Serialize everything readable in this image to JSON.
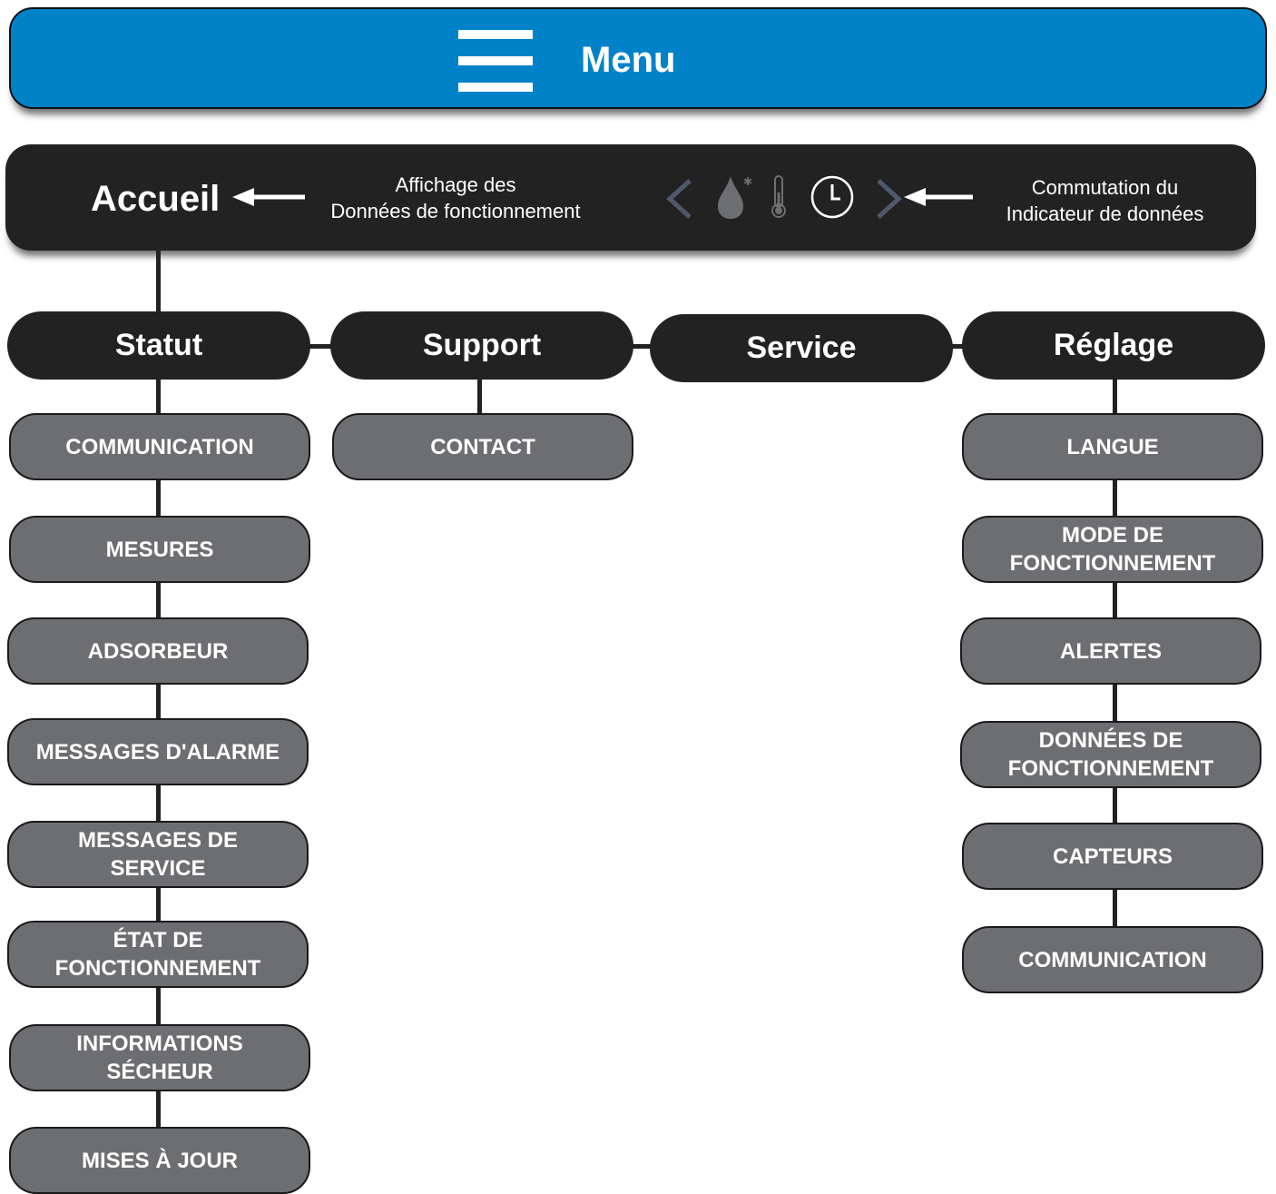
{
  "menu": {
    "title": "Menu",
    "icon": "hamburger-icon",
    "color": "#0082c9"
  },
  "home": {
    "title": "Accueil",
    "annotation_data_display": "Affichage des\nDonnées de fonctionnement",
    "annotation_indicator_switch": "Commutation du\nIndicateur de données",
    "icons": [
      "chevron-left-icon",
      "water-drop-icon",
      "thermometer-icon",
      "clock-icon",
      "chevron-right-icon"
    ]
  },
  "categories": {
    "statut": {
      "label": "Statut",
      "items": [
        "COMMUNICATION",
        "MESURES",
        "ADSORBEUR",
        "MESSAGES D'ALARME",
        "MESSAGES DE\nSERVICE",
        "ÉTAT DE\nFONCTIONNEMENT",
        "INFORMATIONS\nSÉCHEUR",
        "MISES À JOUR"
      ]
    },
    "support": {
      "label": "Support",
      "items": [
        "CONTACT"
      ]
    },
    "service": {
      "label": "Service",
      "items": []
    },
    "reglage": {
      "label": "Réglage",
      "items": [
        "LANGUE",
        "MODE DE\nFONCTIONNEMENT",
        "ALERTES",
        "DONNÉES DE\nFONCTIONNEMENT",
        "CAPTEURS",
        "COMMUNICATION"
      ]
    }
  }
}
